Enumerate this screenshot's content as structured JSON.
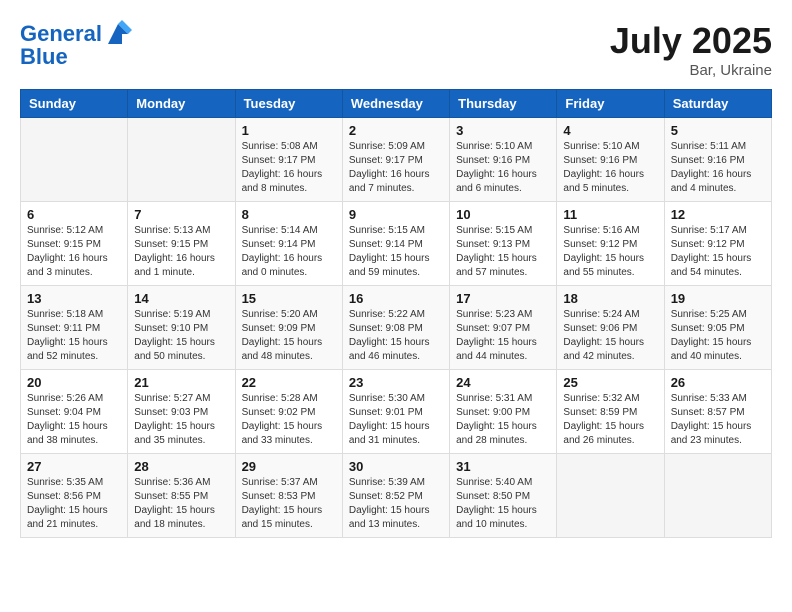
{
  "header": {
    "logo_line1": "General",
    "logo_line2": "Blue",
    "month_year": "July 2025",
    "location": "Bar, Ukraine"
  },
  "weekdays": [
    "Sunday",
    "Monday",
    "Tuesday",
    "Wednesday",
    "Thursday",
    "Friday",
    "Saturday"
  ],
  "weeks": [
    [
      {
        "day": "",
        "info": ""
      },
      {
        "day": "",
        "info": ""
      },
      {
        "day": "1",
        "info": "Sunrise: 5:08 AM\nSunset: 9:17 PM\nDaylight: 16 hours\nand 8 minutes."
      },
      {
        "day": "2",
        "info": "Sunrise: 5:09 AM\nSunset: 9:17 PM\nDaylight: 16 hours\nand 7 minutes."
      },
      {
        "day": "3",
        "info": "Sunrise: 5:10 AM\nSunset: 9:16 PM\nDaylight: 16 hours\nand 6 minutes."
      },
      {
        "day": "4",
        "info": "Sunrise: 5:10 AM\nSunset: 9:16 PM\nDaylight: 16 hours\nand 5 minutes."
      },
      {
        "day": "5",
        "info": "Sunrise: 5:11 AM\nSunset: 9:16 PM\nDaylight: 16 hours\nand 4 minutes."
      }
    ],
    [
      {
        "day": "6",
        "info": "Sunrise: 5:12 AM\nSunset: 9:15 PM\nDaylight: 16 hours\nand 3 minutes."
      },
      {
        "day": "7",
        "info": "Sunrise: 5:13 AM\nSunset: 9:15 PM\nDaylight: 16 hours\nand 1 minute."
      },
      {
        "day": "8",
        "info": "Sunrise: 5:14 AM\nSunset: 9:14 PM\nDaylight: 16 hours\nand 0 minutes."
      },
      {
        "day": "9",
        "info": "Sunrise: 5:15 AM\nSunset: 9:14 PM\nDaylight: 15 hours\nand 59 minutes."
      },
      {
        "day": "10",
        "info": "Sunrise: 5:15 AM\nSunset: 9:13 PM\nDaylight: 15 hours\nand 57 minutes."
      },
      {
        "day": "11",
        "info": "Sunrise: 5:16 AM\nSunset: 9:12 PM\nDaylight: 15 hours\nand 55 minutes."
      },
      {
        "day": "12",
        "info": "Sunrise: 5:17 AM\nSunset: 9:12 PM\nDaylight: 15 hours\nand 54 minutes."
      }
    ],
    [
      {
        "day": "13",
        "info": "Sunrise: 5:18 AM\nSunset: 9:11 PM\nDaylight: 15 hours\nand 52 minutes."
      },
      {
        "day": "14",
        "info": "Sunrise: 5:19 AM\nSunset: 9:10 PM\nDaylight: 15 hours\nand 50 minutes."
      },
      {
        "day": "15",
        "info": "Sunrise: 5:20 AM\nSunset: 9:09 PM\nDaylight: 15 hours\nand 48 minutes."
      },
      {
        "day": "16",
        "info": "Sunrise: 5:22 AM\nSunset: 9:08 PM\nDaylight: 15 hours\nand 46 minutes."
      },
      {
        "day": "17",
        "info": "Sunrise: 5:23 AM\nSunset: 9:07 PM\nDaylight: 15 hours\nand 44 minutes."
      },
      {
        "day": "18",
        "info": "Sunrise: 5:24 AM\nSunset: 9:06 PM\nDaylight: 15 hours\nand 42 minutes."
      },
      {
        "day": "19",
        "info": "Sunrise: 5:25 AM\nSunset: 9:05 PM\nDaylight: 15 hours\nand 40 minutes."
      }
    ],
    [
      {
        "day": "20",
        "info": "Sunrise: 5:26 AM\nSunset: 9:04 PM\nDaylight: 15 hours\nand 38 minutes."
      },
      {
        "day": "21",
        "info": "Sunrise: 5:27 AM\nSunset: 9:03 PM\nDaylight: 15 hours\nand 35 minutes."
      },
      {
        "day": "22",
        "info": "Sunrise: 5:28 AM\nSunset: 9:02 PM\nDaylight: 15 hours\nand 33 minutes."
      },
      {
        "day": "23",
        "info": "Sunrise: 5:30 AM\nSunset: 9:01 PM\nDaylight: 15 hours\nand 31 minutes."
      },
      {
        "day": "24",
        "info": "Sunrise: 5:31 AM\nSunset: 9:00 PM\nDaylight: 15 hours\nand 28 minutes."
      },
      {
        "day": "25",
        "info": "Sunrise: 5:32 AM\nSunset: 8:59 PM\nDaylight: 15 hours\nand 26 minutes."
      },
      {
        "day": "26",
        "info": "Sunrise: 5:33 AM\nSunset: 8:57 PM\nDaylight: 15 hours\nand 23 minutes."
      }
    ],
    [
      {
        "day": "27",
        "info": "Sunrise: 5:35 AM\nSunset: 8:56 PM\nDaylight: 15 hours\nand 21 minutes."
      },
      {
        "day": "28",
        "info": "Sunrise: 5:36 AM\nSunset: 8:55 PM\nDaylight: 15 hours\nand 18 minutes."
      },
      {
        "day": "29",
        "info": "Sunrise: 5:37 AM\nSunset: 8:53 PM\nDaylight: 15 hours\nand 15 minutes."
      },
      {
        "day": "30",
        "info": "Sunrise: 5:39 AM\nSunset: 8:52 PM\nDaylight: 15 hours\nand 13 minutes."
      },
      {
        "day": "31",
        "info": "Sunrise: 5:40 AM\nSunset: 8:50 PM\nDaylight: 15 hours\nand 10 minutes."
      },
      {
        "day": "",
        "info": ""
      },
      {
        "day": "",
        "info": ""
      }
    ]
  ]
}
